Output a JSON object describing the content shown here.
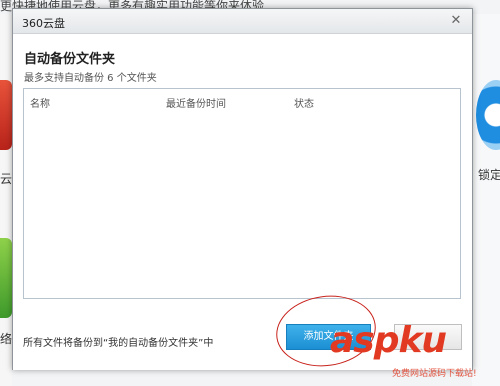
{
  "background": {
    "top_text": "更快捷地使用云盘，更多有趣实用功能等你来体验",
    "left_chars": [
      "云",
      "络"
    ],
    "right_label": "锁定"
  },
  "dialog": {
    "title": "360云盘",
    "close_glyph": "✕",
    "heading": "自动备份文件夹",
    "subheading": "最多支持自动备份 6 个文件夹",
    "columns": [
      "名称",
      "最近备份时间",
      "状态"
    ],
    "rows": [],
    "footer_text": "所有文件将备份到“我的自动备份文件夹”中",
    "add_button_label": "添加文件夹"
  },
  "watermark": {
    "logo": "aspku",
    "subtitle": "免费网站源码下载站!"
  },
  "colors": {
    "accent": "#1c8fd4",
    "annotation": "#c8221b",
    "watermark": "#e23a22"
  }
}
